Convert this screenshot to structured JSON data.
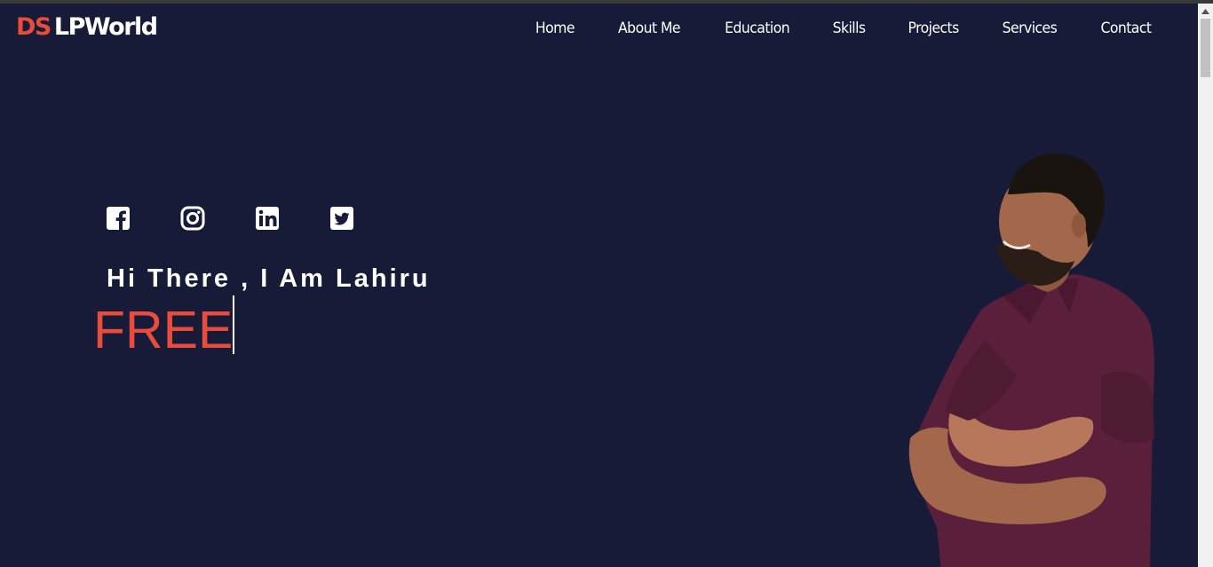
{
  "header": {
    "logo_prefix": "DS",
    "logo_rest": "LPWorld",
    "nav": [
      {
        "label": "Home"
      },
      {
        "label": "About Me"
      },
      {
        "label": "Education"
      },
      {
        "label": "Skills"
      },
      {
        "label": "Projects"
      },
      {
        "label": "Services"
      },
      {
        "label": "Contact"
      }
    ]
  },
  "hero": {
    "greeting": "Hi There , I Am Lahiru",
    "typed_text": "FREE",
    "socials": [
      {
        "icon": "facebook-icon"
      },
      {
        "icon": "instagram-icon"
      },
      {
        "icon": "linkedin-icon"
      },
      {
        "icon": "twitter-icon"
      }
    ]
  },
  "colors": {
    "background": "#171b38",
    "accent": "#e74c3c",
    "text": "#ffffff"
  }
}
